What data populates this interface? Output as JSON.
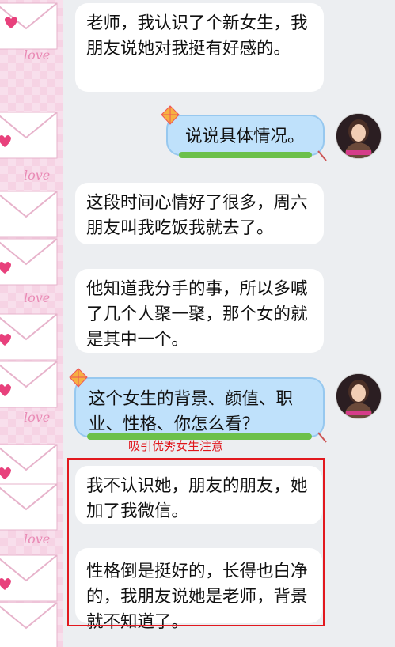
{
  "messages": [
    {
      "id": "m1",
      "side": "in",
      "text": "老师，我认识了个新女生，我朋友说她对我挺有好感的。"
    },
    {
      "id": "m2",
      "side": "out",
      "text": "说说具体情况。"
    },
    {
      "id": "m3",
      "side": "in",
      "text": "这段时间心情好了很多，周六朋友叫我吃饭我就去了。"
    },
    {
      "id": "m4",
      "side": "in",
      "text": "他知道我分手的事，所以多喊了几个人聚一聚，那个女的就是其中一个。"
    },
    {
      "id": "m5",
      "side": "out",
      "text": "这个女生的背景、颜值、职业、性格、你怎么看？"
    },
    {
      "id": "m6",
      "side": "in",
      "text": "我不认识她，朋友的朋友，她加了我微信。"
    },
    {
      "id": "m7",
      "side": "in",
      "text": "性格倒是挺好的，长得也白净的，我朋友说她是老师，背景就不知道了。"
    }
  ],
  "annotation": "吸引优秀女生注意",
  "decor_text": "love",
  "colors": {
    "accent_red": "#e2181e",
    "bubble_out": "#bfe1fb",
    "bubble_in": "#ffffff",
    "strip": "#f6d3e4"
  }
}
